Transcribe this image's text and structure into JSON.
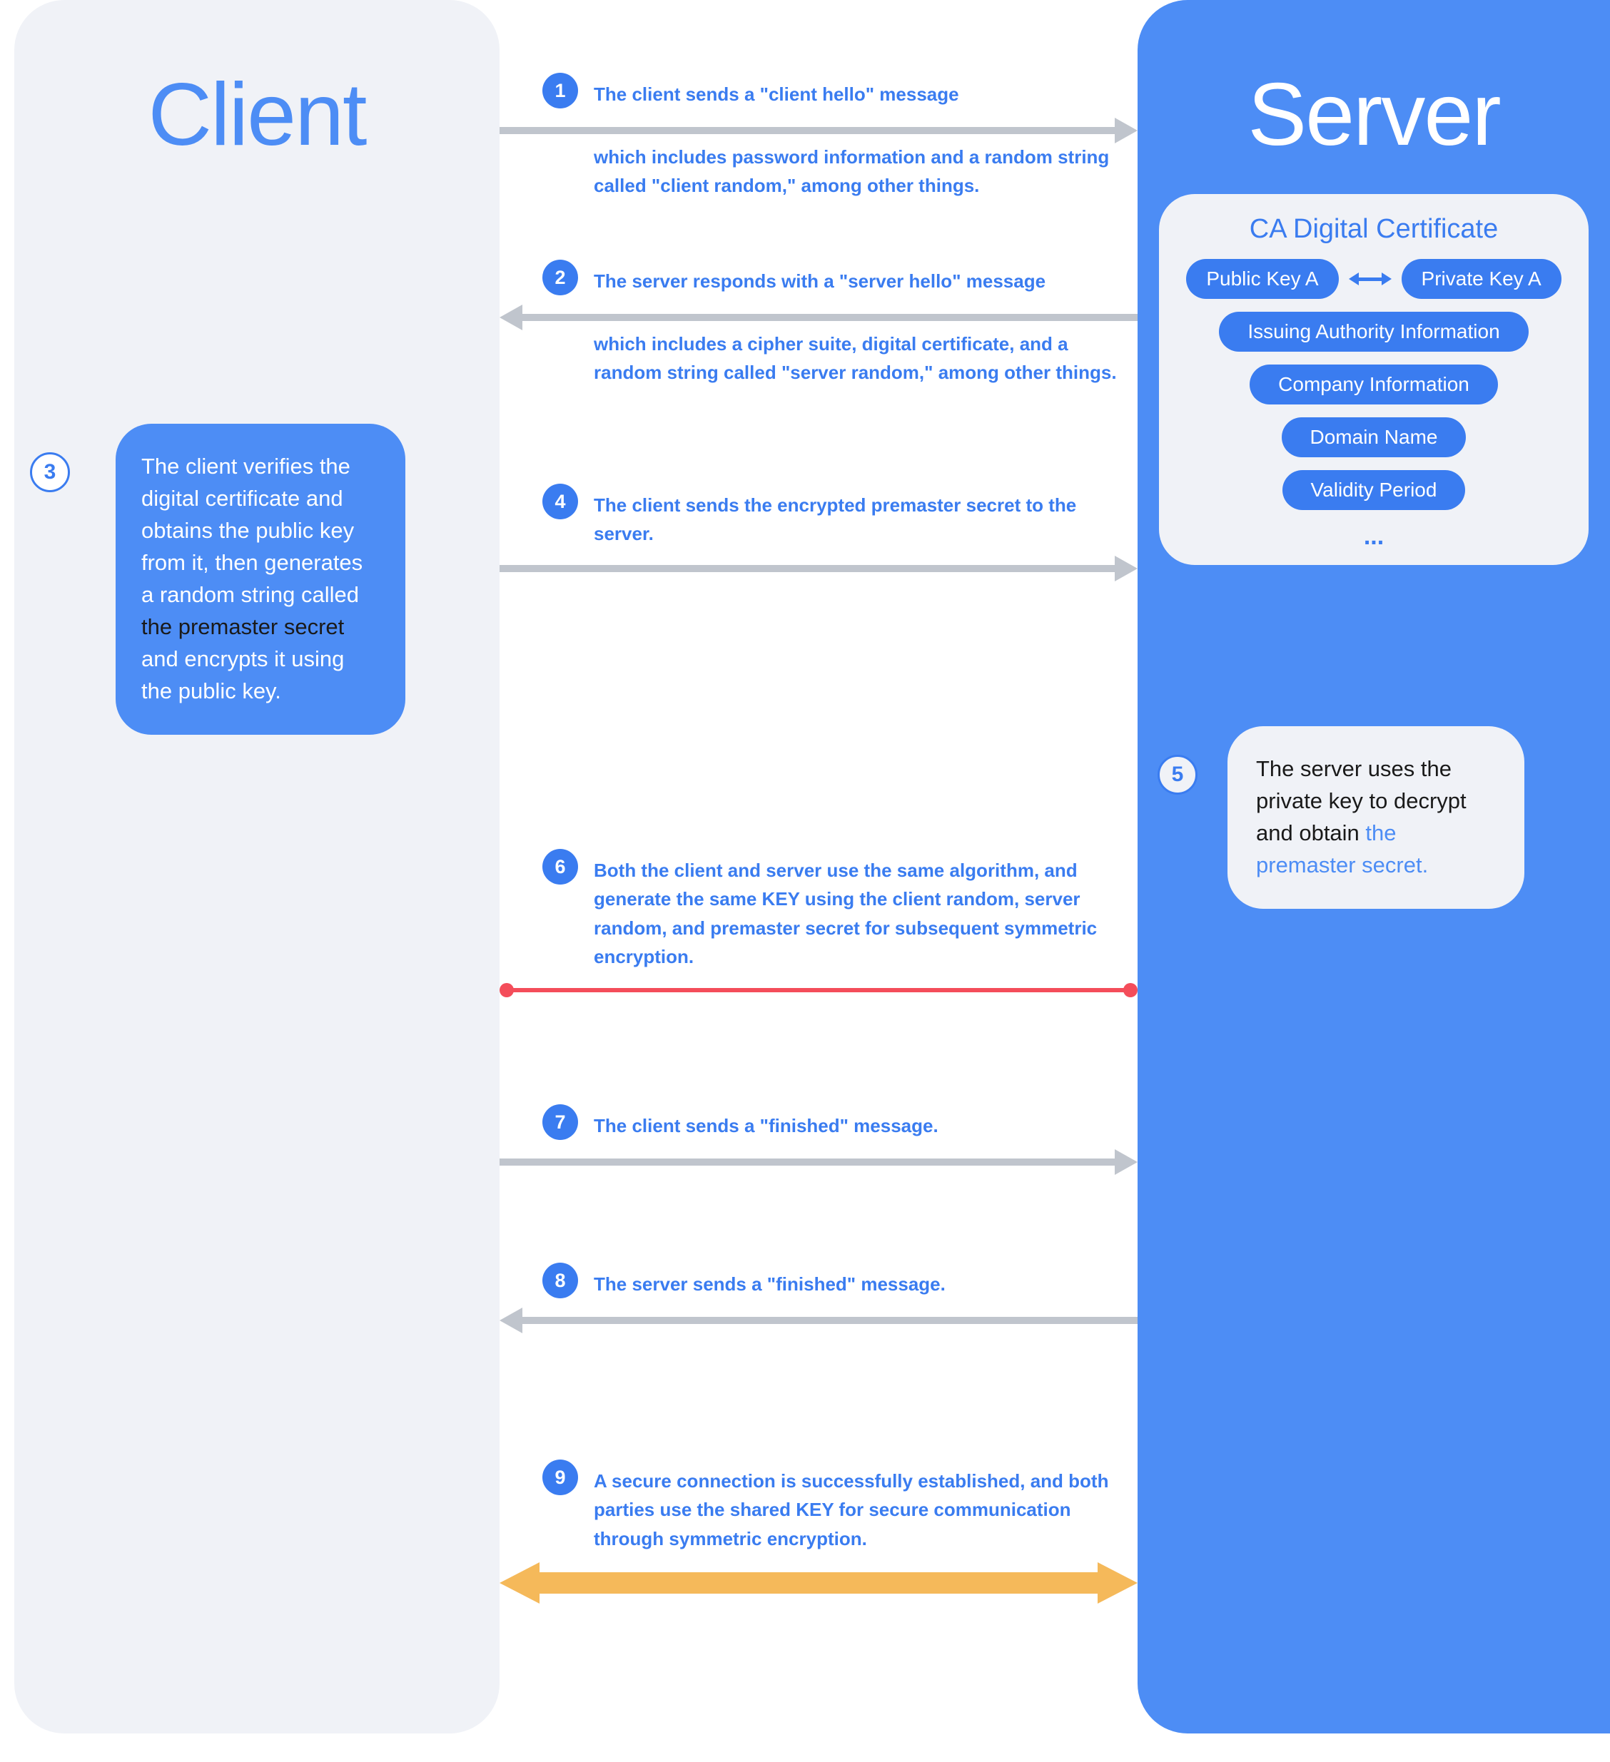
{
  "client_title": "Client",
  "server_title": "Server",
  "cert": {
    "title": "CA Digital Certificate",
    "public_key": "Public Key A",
    "private_key": "Private Key A",
    "issuing": "Issuing Authority Information",
    "company": "Company Information",
    "domain": "Domain Name",
    "validity": "Validity Period",
    "more": "..."
  },
  "steps": {
    "s1": {
      "num": "1",
      "line1": "The client sends a \"client hello\" message",
      "line2": "which includes password information and a random string called \"client random,\" among other things."
    },
    "s2": {
      "num": "2",
      "line1": "The server responds with a \"server hello\" message",
      "line2": "which includes a cipher suite, digital certificate, and a random string called \"server random,\" among other things."
    },
    "s3": {
      "num": "3",
      "pre": "The client verifies the digital certificate and obtains the public key from it, then generates a random string called ",
      "dark": "the premaster secret ",
      "post": "and encrypts it using the public key."
    },
    "s4": {
      "num": "4",
      "line1": "The client sends the encrypted premaster secret to the server."
    },
    "s5": {
      "num": "5",
      "pre": "The server uses the private key to decrypt and obtain ",
      "blue": "the premaster secret."
    },
    "s6": {
      "num": "6",
      "line1": "Both the client and server use the same algorithm, and generate the same KEY using the client random, server random, and premaster secret for subsequent symmetric encryption."
    },
    "s7": {
      "num": "7",
      "line1": "The client sends a \"finished\" message."
    },
    "s8": {
      "num": "8",
      "line1": "The server sends a \"finished\" message."
    },
    "s9": {
      "num": "9",
      "line1": "A secure connection is successfully established, and both parties use the shared KEY for secure communication through symmetric encryption."
    }
  }
}
